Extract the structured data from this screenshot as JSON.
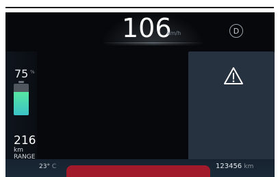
{
  "speed": {
    "value": "106",
    "unit": "km/h"
  },
  "gear": "D",
  "battery": {
    "percent_value": "75",
    "percent_unit": "%",
    "level": 0.75,
    "fill_color": "#57e6a2"
  },
  "range": {
    "value": "216",
    "unit": "km",
    "label": "RANGE"
  },
  "temperature": {
    "value": "23°",
    "unit": "C"
  },
  "odometer": {
    "value": "123456",
    "unit": "km"
  },
  "warning": {
    "icon": "warning-triangle-icon"
  },
  "colors": {
    "background": "#06080b",
    "warning_bar": "#a11a2c",
    "panel": "#26323f"
  }
}
